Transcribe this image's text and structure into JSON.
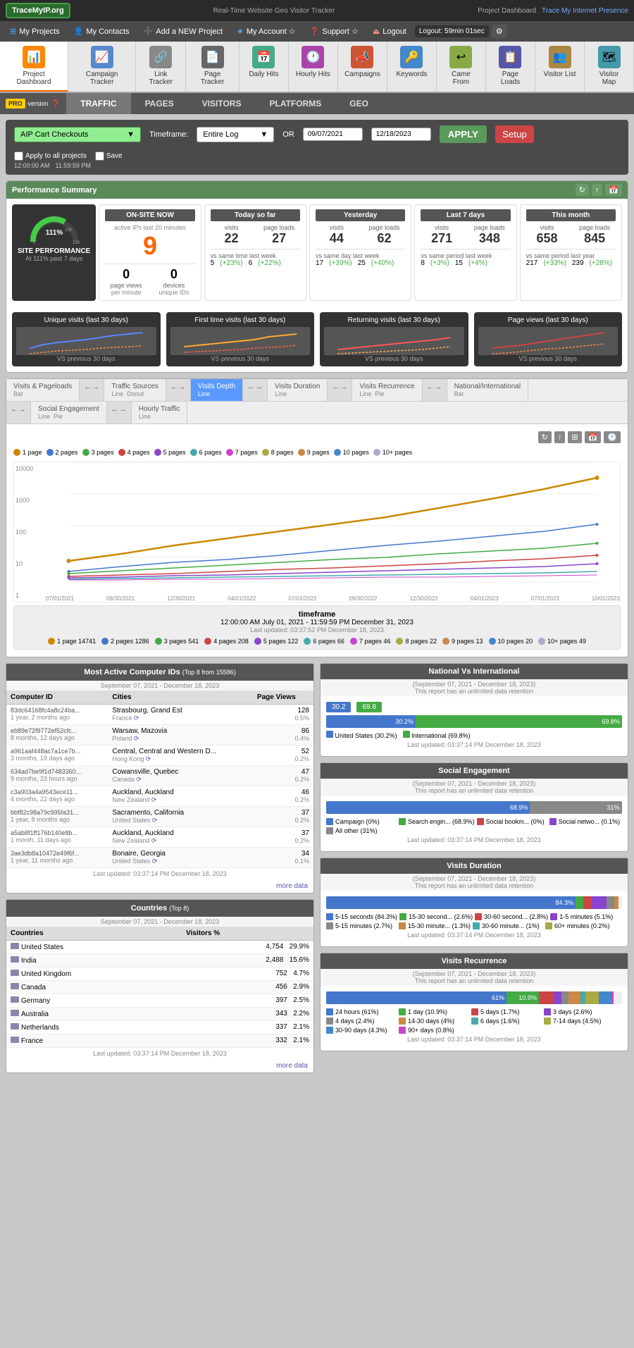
{
  "header": {
    "logo": "TraceMyIP.org",
    "center_text": "Real-Time Website Geo Visitor Tracker",
    "right_text": "Project Dashboard",
    "trace_link": "Trace My Internet Presence"
  },
  "nav": {
    "items": [
      {
        "label": "My Projects",
        "icon": "projects-icon"
      },
      {
        "label": "My Contacts",
        "icon": "contacts-icon"
      },
      {
        "label": "Add a NEW Project",
        "icon": "add-icon"
      },
      {
        "label": "My Account ☆",
        "icon": "account-icon"
      },
      {
        "label": "Support ☆",
        "icon": "support-icon"
      },
      {
        "label": "Logout",
        "icon": "logout-icon"
      }
    ],
    "logout_timer": "Logout: 59min 01sec"
  },
  "icon_toolbar": {
    "items": [
      {
        "label": "Project Dashboard",
        "icon": "📊",
        "active": true
      },
      {
        "label": "Campaign Tracker",
        "icon": "📈"
      },
      {
        "label": "Link Tracker",
        "icon": "🔗"
      },
      {
        "label": "Page Tracker",
        "icon": "📄"
      },
      {
        "label": "Daily Hits",
        "icon": "📅"
      },
      {
        "label": "Hourly Hits",
        "icon": "🕐"
      },
      {
        "label": "Campaigns",
        "icon": "📣"
      },
      {
        "label": "Keywords",
        "icon": "🔑"
      },
      {
        "label": "Came From",
        "icon": "↩"
      },
      {
        "label": "Page Loads",
        "icon": "📋"
      },
      {
        "label": "Visitor List",
        "icon": "👥"
      },
      {
        "label": "Visitor Map",
        "icon": "🗺"
      }
    ]
  },
  "sub_nav": {
    "items": [
      "TRAFFIC",
      "PAGES",
      "VISITORS",
      "PLATFORMS",
      "GEO"
    ]
  },
  "filter": {
    "dropdown_label": "AIP Cart Checkouts",
    "timeframe_label": "Timeframe:",
    "timeframe_value": "Entire Log",
    "or_label": "OR",
    "date_from": "09/07/2021",
    "date_to": "12/18/2023",
    "time_from": "12:00:00 AM",
    "time_to": "11:59:59 PM",
    "apply_label": "APPLY",
    "setup_label": "Setup",
    "check1": "Apply to all projects",
    "check2": "Save"
  },
  "performance": {
    "title": "Performance Summary",
    "gauge_pct": 111,
    "gauge_label": "SITE PERFORMANCE",
    "gauge_sub": "At 111% past 7 days",
    "on_site_now": {
      "title": "ON-SITE NOW",
      "sub": "active IPs last 20 minutes",
      "value": "9",
      "page_views_label": "page views",
      "page_views_val": "0",
      "devices_label": "devices",
      "devices_val": "0",
      "per_minute": "per minute",
      "unique_ids": "unique IDs"
    },
    "today": {
      "title": "Today so far",
      "visits_label": "visits",
      "visits_val": "22",
      "page_loads_label": "page loads",
      "page_loads_val": "27",
      "vs_label": "vs same time last week",
      "vs_visits": "5",
      "vs_visits_pct": "(+23%)",
      "vs_loads": "6",
      "vs_loads_pct": "(+22%)"
    },
    "yesterday": {
      "title": "Yesterday",
      "visits_val": "44",
      "loads_val": "62",
      "vs_label": "vs same day last week",
      "vs_visits": "17",
      "vs_visits_pct": "(+39%)",
      "vs_loads": "25",
      "vs_loads_pct": "(+40%)"
    },
    "last7": {
      "title": "Last 7 days",
      "visits_val": "271",
      "loads_val": "348",
      "vs_label": "vs same period last week",
      "vs_visits": "8",
      "vs_visits_pct": "(+3%)",
      "vs_loads": "15",
      "vs_loads_pct": "(+4%)"
    },
    "thismonth": {
      "title": "This month",
      "visits_val": "658",
      "loads_val": "845",
      "vs_label": "vs same period last year",
      "vs_visits": "217",
      "vs_visits_pct": "(+33%)",
      "vs_loads": "239",
      "vs_loads_pct": "(+28%)"
    }
  },
  "sparklines": [
    {
      "title": "Unique visits (last 30 days)",
      "vs": "VS previous 30 days"
    },
    {
      "title": "First time visits (last 30 days)",
      "vs": "VS previous 30 days"
    },
    {
      "title": "Returning visits (last 30 days)",
      "vs": "VS previous 30 days"
    },
    {
      "title": "Page views (last 30 days)",
      "vs": "VS previous 30 days"
    }
  ],
  "chart_tabs": {
    "rows": [
      [
        {
          "label": "Visits & Pageloads",
          "sub": "Bar",
          "active": false
        },
        {
          "label": "←→",
          "arrow": true
        },
        {
          "label": "Traffic Sources",
          "sub": "Line Donut",
          "active": false
        },
        {
          "label": "←→",
          "arrow": true
        },
        {
          "label": "Visits Depth",
          "sub": "Line",
          "active": true
        },
        {
          "label": "←→",
          "arrow": true
        },
        {
          "label": "Visits Duration",
          "sub": "Line",
          "active": false
        },
        {
          "label": "←→",
          "arrow": true
        },
        {
          "label": "Visits Recurrence",
          "sub": "Line Pie",
          "active": false
        },
        {
          "label": "←→",
          "arrow": true
        },
        {
          "label": "National/International",
          "sub": "Bar",
          "active": false
        }
      ],
      [
        {
          "label": "←→",
          "arrow": true
        },
        {
          "label": "Social Engagement",
          "sub": "Line Pie",
          "active": false
        },
        {
          "label": "←→",
          "arrow": true
        },
        {
          "label": "Hourly Traffic",
          "sub": "Line",
          "active": false
        }
      ]
    ]
  },
  "chart": {
    "legend_items": [
      {
        "label": "1 page",
        "color": "#cc8800"
      },
      {
        "label": "2 pages",
        "color": "#4477cc"
      },
      {
        "label": "3 pages",
        "color": "#44aa44"
      },
      {
        "label": "4 pages",
        "color": "#cc4444"
      },
      {
        "label": "5 pages",
        "color": "#8844cc"
      },
      {
        "label": "6 pages",
        "color": "#44aaaa"
      },
      {
        "label": "7 pages",
        "color": "#cc44cc"
      },
      {
        "label": "8 pages",
        "color": "#aaaa44"
      },
      {
        "label": "9 pages",
        "color": "#cc8844"
      },
      {
        "label": "10 pages",
        "color": "#4488cc"
      },
      {
        "label": "10+ pages",
        "color": "#aaaacc"
      }
    ],
    "y_labels": [
      "10000",
      "1000",
      "100",
      "10",
      "1"
    ],
    "x_labels": [
      "07/01/2021",
      "09/30/2021",
      "12/30/2021",
      "04/01/2022",
      "07/01/2022",
      "09/30/2022",
      "12/30/2022",
      "04/01/2023",
      "07/01/2023",
      "10/01/2023"
    ],
    "timeframe_title": "timeframe",
    "timeframe_range": "12:00:00 AM July 01, 2021 - 11:59:59 PM December 31, 2023",
    "timeframe_updated": "Last updated: 03:37:52 PM December 18, 2023",
    "tf_legend": [
      {
        "label": "1 page",
        "value": "14741",
        "color": "#cc8800"
      },
      {
        "label": "2 pages",
        "value": "1286",
        "color": "#4477cc"
      },
      {
        "label": "3 pages",
        "value": "541",
        "color": "#44aa44"
      },
      {
        "label": "4 pages",
        "value": "208",
        "color": "#cc4444"
      },
      {
        "label": "5 pages",
        "value": "122",
        "color": "#8844cc"
      },
      {
        "label": "6 pages",
        "value": "66",
        "color": "#44aaaa"
      },
      {
        "label": "7 pages",
        "value": "46",
        "color": "#cc44cc"
      },
      {
        "label": "8 pages",
        "value": "22",
        "color": "#aaaa44"
      },
      {
        "label": "9 pages",
        "value": "13",
        "color": "#cc8844"
      },
      {
        "label": "10 pages",
        "value": "20",
        "color": "#4488cc"
      },
      {
        "label": "10+ pages",
        "value": "49",
        "color": "#aaaacc"
      }
    ]
  },
  "computer_ids": {
    "title": "Most Active Computer IDs",
    "top_label": "Top 8 from 15586",
    "date_range": "September 07, 2021 - December 18, 2023",
    "columns": [
      "Computer ID",
      "Cities",
      "Page Views"
    ],
    "rows": [
      {
        "id": "83dc64168fc4a8c24ba...",
        "age": "1 year, 2 months ago",
        "city": "Strasbourg, Grand Est",
        "country": "France",
        "views": "128",
        "pct": "0.5%"
      },
      {
        "id": "eb89e72f9772ef52cfc...",
        "age": "8 months, 12 days ago",
        "city": "Warsaw, Mazovia",
        "country": "Poland",
        "views": "86",
        "pct": "0.4%"
      },
      {
        "id": "a961aaf448ac7a1ce7b...",
        "age": "3 months, 19 days ago",
        "city": "Central, Central and Western D...",
        "country": "Hong Kong",
        "views": "52",
        "pct": "0.2%"
      },
      {
        "id": "634ad7be9f1d7483360...",
        "age": "9 months, 23 hours ago",
        "city": "Cowansville, Quebec",
        "country": "Canada",
        "views": "47",
        "pct": "0.2%"
      },
      {
        "id": "c3a903a4a9543ece11...",
        "age": "4 months, 22 days ago",
        "city": "Auckland, Auckland",
        "country": "New Zealand",
        "views": "46",
        "pct": "0.2%"
      },
      {
        "id": "bbf82c98a79c995fa31...",
        "age": "1 year, 8 months ago",
        "city": "Sacramento, California",
        "country": "United States",
        "views": "37",
        "pct": "0.2%"
      },
      {
        "id": "a5ab8f1ff176b140e8b...",
        "age": "1 month, 11 days ago",
        "city": "Auckland, Auckland",
        "country": "New Zealand",
        "views": "37",
        "pct": "0.2%"
      },
      {
        "id": "3ae3db8a10472e49f6f...",
        "age": "1 year, 11 months ago",
        "city": "Bonaire, Georgia",
        "country": "United States",
        "views": "34",
        "pct": "0.1%"
      }
    ],
    "last_updated": "Last updated: 03:37:14 PM December 18, 2023",
    "more_link": "more data"
  },
  "countries": {
    "title": "Countries",
    "top_label": "Top 8",
    "date_range": "September 07, 2021 - December 18, 2023",
    "columns": [
      "Countries",
      "Visitors %"
    ],
    "rows": [
      {
        "name": "United States",
        "visits": "4,754",
        "pct": "29.9%"
      },
      {
        "name": "India",
        "visits": "2,488",
        "pct": "15.6%"
      },
      {
        "name": "United Kingdom",
        "visits": "752",
        "pct": "4.7%"
      },
      {
        "name": "Canada",
        "visits": "456",
        "pct": "2.9%"
      },
      {
        "name": "Germany",
        "visits": "397",
        "pct": "2.5%"
      },
      {
        "name": "Australia",
        "visits": "343",
        "pct": "2.2%"
      },
      {
        "name": "Netherlands",
        "visits": "337",
        "pct": "2.1%"
      },
      {
        "name": "France",
        "visits": "332",
        "pct": "2.1%"
      }
    ],
    "last_updated": "Last updated: 03:37:14 PM December 18, 2023",
    "more_link": "more data"
  },
  "national_vs_intl": {
    "title": "National Vs International",
    "date_range": "(September 07, 2021 - December 18, 2023)",
    "note": "This report has an unlimited data retention",
    "us_pct": 30.2,
    "intl_pct": 69.8,
    "us_label": "United States (30.2%)",
    "intl_label": "International (69.8%)",
    "last_updated": "Last updated: 03:37:14 PM December 18, 2023"
  },
  "social_engagement": {
    "title": "Social Engagement",
    "date_range": "(September 07, 2021 - December 18, 2023)",
    "note": "This report has an unlimited data retention",
    "bars": [
      {
        "label": "Campaign (0%)",
        "pct": 68.9,
        "color": "#4477cc"
      },
      {
        "label": "Search engin... (68.9%)",
        "pct": 68.9,
        "color": "#44aa44"
      },
      {
        "label": "Social bookm... (0%)",
        "pct": 0.5,
        "color": "#cc4444"
      },
      {
        "label": "Social netwo... (0.1%)",
        "pct": 0.1,
        "color": "#8844cc"
      },
      {
        "label": "All other (31%)",
        "pct": 31,
        "color": "#888"
      }
    ],
    "bar_labels": [
      "Campaign (0%)",
      "Search engin... (68.9%)",
      "Social bookm... (0%)",
      "Social netwo... (0.1%)",
      "All other (31%)"
    ],
    "top_bar_green_pct": 68.9,
    "top_bar_gray_pct": 31,
    "last_updated": "Last updated: 03:37:14 PM December 18, 2023"
  },
  "visits_duration": {
    "title": "Visits Duration",
    "date_range": "(September 07, 2021 - December 18, 2023)",
    "note": "This report has an unlimited data retention",
    "main_bar_pct": 84.3,
    "legend": [
      {
        "label": "5-15 seconds (84.3%)",
        "color": "#4477cc"
      },
      {
        "label": "15-30 second... (2.6%)",
        "color": "#44aa44"
      },
      {
        "label": "30-60 second... (2.8%)",
        "color": "#cc4444"
      },
      {
        "label": "1-5 minutes (5.1%)",
        "color": "#8844cc"
      },
      {
        "label": "5-15 minutes (2.7%)",
        "color": "#888"
      },
      {
        "label": "15-30 minute... (1.3%)",
        "color": "#cc8844"
      },
      {
        "label": "30-60 minute... (1%)",
        "color": "#44aaaa"
      },
      {
        "label": "60+ minutes (0.2%)",
        "color": "#aaaa44"
      }
    ],
    "last_updated": "Last updated: 03:37:14 PM December 18, 2023"
  },
  "visits_recurrence": {
    "title": "Visits Recurrence",
    "date_range": "(September 07, 2021 - December 18, 2023)",
    "note": "This report has an unlimited data retention",
    "bar_61_pct": 61,
    "bar_10_9_pct": 10.9,
    "legend": [
      {
        "label": "24 hours (61%)",
        "color": "#4477cc"
      },
      {
        "label": "1 day (10.9%)",
        "color": "#44aa44"
      },
      {
        "label": "5 days (1.7%)",
        "color": "#cc4444"
      },
      {
        "label": "3 days (2.6%)",
        "color": "#8844cc"
      },
      {
        "label": "4 days (2.4%)",
        "color": "#888"
      },
      {
        "label": "14-30 days (4%)",
        "color": "#cc8844"
      },
      {
        "label": "6 days (1.6%)",
        "color": "#44aaaa"
      },
      {
        "label": "7-14 days (4.5%)",
        "color": "#aaaa44"
      },
      {
        "label": "30-90 days (4.3%)",
        "color": "#4488cc"
      },
      {
        "label": "90+ days (0.8%)",
        "color": "#cc44cc"
      }
    ],
    "last_updated": "Last updated: 03:37:14 PM December 18, 2023"
  }
}
